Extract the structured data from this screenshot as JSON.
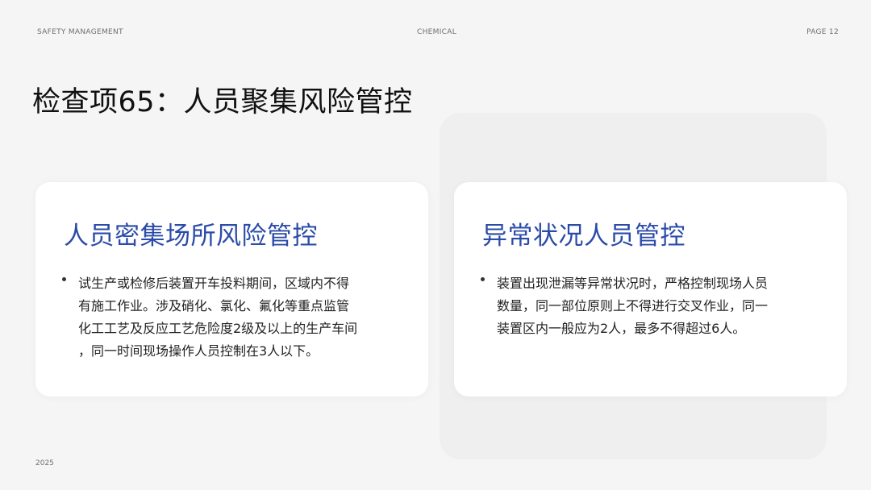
{
  "header": {
    "left": "SAFETY MANAGEMENT",
    "center": "CHEMICAL",
    "right": "PAGE 12"
  },
  "title": "检查项65：人员聚集风险管控",
  "cards": [
    {
      "title": "人员密集场所风险管控",
      "lines": [
        "试生产或检修后装置开车投料期间，区域内不得",
        "有施工作业。涉及硝化、氯化、氟化等重点监管",
        "化工工艺及反应工艺危险度2级及以上的生产车间",
        "，同一时间现场操作人员控制在3人以下。"
      ]
    },
    {
      "title": "异常状况人员管控",
      "lines": [
        "装置出现泄漏等异常状况时，严格控制现场人员",
        "数量，同一部位原则上不得进行交叉作业，同一",
        "装置区内一般应为2人，最多不得超过6人。"
      ]
    }
  ],
  "footer": {
    "year": "2025"
  },
  "colors": {
    "background": "#f5f5f5",
    "card": "#ffffff",
    "accent": "#2b4ba8",
    "text": "#222222"
  }
}
